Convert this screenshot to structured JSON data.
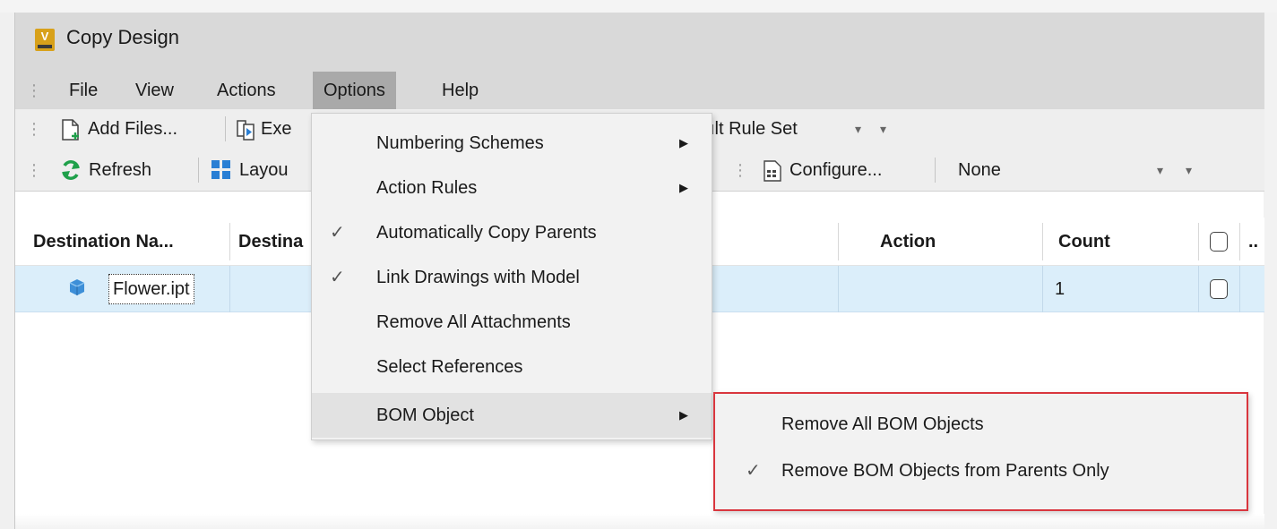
{
  "window": {
    "title": "Copy Design"
  },
  "menubar": {
    "items": [
      {
        "label": "File"
      },
      {
        "label": "View"
      },
      {
        "label": "Actions"
      },
      {
        "label": "Options"
      },
      {
        "label": "Help"
      }
    ]
  },
  "toolbar1": {
    "add_files_label": "Add Files...",
    "execute_label_partial": "Exe",
    "rule_set_partial": "ılt Rule Set"
  },
  "toolbar2": {
    "refresh_label": "Refresh",
    "layout_label_partial": "Layou",
    "configure_label": "Configure...",
    "filter_value": "None"
  },
  "grid": {
    "headers": {
      "destination_name": "Destination Na...",
      "destination_partial": "Destina",
      "action": "Action",
      "count": "Count",
      "more": ".."
    },
    "rows": [
      {
        "name": "Flower.ipt",
        "action": "",
        "count": "1"
      }
    ]
  },
  "options_menu": {
    "items": [
      {
        "label": "Numbering Schemes",
        "checked": false,
        "submenu": true
      },
      {
        "label": "Action Rules",
        "checked": false,
        "submenu": true
      },
      {
        "label": "Automatically Copy Parents",
        "checked": true,
        "submenu": false
      },
      {
        "label": "Link Drawings with Model",
        "checked": true,
        "submenu": false
      },
      {
        "label": "Remove All Attachments",
        "checked": false,
        "submenu": false
      },
      {
        "label": "Select References",
        "checked": false,
        "submenu": false
      },
      {
        "label": "BOM Object",
        "checked": false,
        "submenu": true
      }
    ]
  },
  "bom_submenu": {
    "items": [
      {
        "label": "Remove All BOM Objects",
        "checked": false
      },
      {
        "label": "Remove BOM Objects from Parents Only",
        "checked": true
      }
    ]
  },
  "glyphs": {
    "check": "✓",
    "submenu_arrow": "▶",
    "dropdown_arrow": "▾",
    "grip": "⋮",
    "app_letter": "V"
  },
  "colors": {
    "accent_highlight": "#d9363e",
    "row_selected": "#dbeefa",
    "app_icon": "#d8a11a",
    "refresh_icon": "#1fa04a",
    "layout_icon": "#2a7fd4"
  }
}
